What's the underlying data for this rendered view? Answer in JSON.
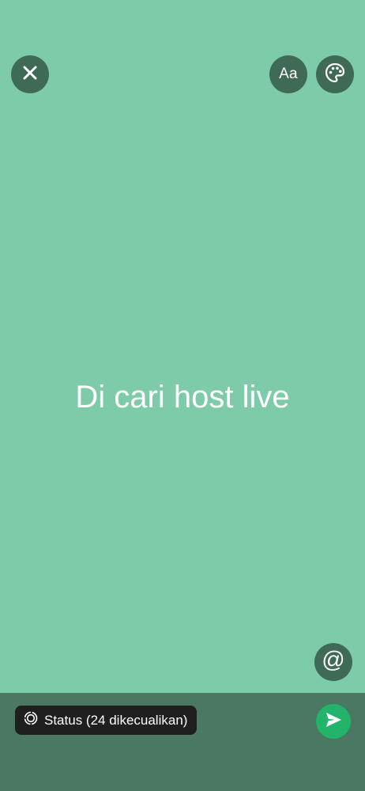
{
  "top_bar": {
    "close_icon": "close-icon",
    "font_button_label": "Aa",
    "palette_icon": "palette-icon"
  },
  "status_text": "Di cari host live",
  "mention_icon": "@",
  "bottom_bar": {
    "audience_icon": "status-ring-icon",
    "audience_label": "Status (24 dikecualikan)",
    "send_icon": "send-icon"
  },
  "colors": {
    "background": "#7ecba9",
    "button_bg": "#3f6a56",
    "bottom_bar": "#4b7862",
    "chip_bg": "#1f1f1f",
    "send_button": "#21b46a"
  }
}
